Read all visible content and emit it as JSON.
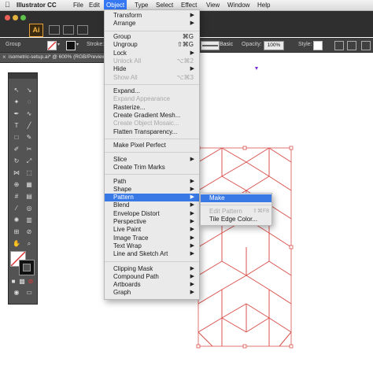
{
  "menubar": {
    "app_name": "Illustrator CC",
    "items": [
      "File",
      "Edit",
      "Object",
      "Type",
      "Select",
      "Effect",
      "View",
      "Window",
      "Help"
    ]
  },
  "appbar": {
    "logo": "Ai"
  },
  "control_bar": {
    "selection_label": "Group",
    "stroke_label": "Stroke:",
    "profile_label": "Basic",
    "opacity_label": "Opacity:",
    "opacity_value": "100%",
    "style_label": "Style:"
  },
  "document_tab": {
    "close": "×",
    "title": "isometric-setup.ai* @ 600% (RGB/Preview)"
  },
  "object_menu": {
    "items": [
      {
        "label": "Transform",
        "arrow": "▶"
      },
      {
        "label": "Arrange",
        "arrow": "▶"
      },
      {
        "label": "Group",
        "shortcut": "⌘G"
      },
      {
        "label": "Ungroup",
        "shortcut": "⇧⌘G"
      },
      {
        "label": "Lock",
        "arrow": "▶"
      },
      {
        "label": "Unlock All",
        "shortcut": "⌥⌘2"
      },
      {
        "label": "Hide",
        "arrow": "▶"
      },
      {
        "label": "Show All",
        "shortcut": "⌥⌘3"
      },
      {
        "label": "Expand..."
      },
      {
        "label": "Expand Appearance"
      },
      {
        "label": "Rasterize..."
      },
      {
        "label": "Create Gradient Mesh..."
      },
      {
        "label": "Create Object Mosaic..."
      },
      {
        "label": "Flatten Transparency..."
      },
      {
        "label": "Make Pixel Perfect"
      },
      {
        "label": "Slice",
        "arrow": "▶"
      },
      {
        "label": "Create Trim Marks"
      },
      {
        "label": "Path",
        "arrow": "▶"
      },
      {
        "label": "Shape",
        "arrow": "▶"
      },
      {
        "label": "Pattern",
        "arrow": "▶"
      },
      {
        "label": "Blend",
        "arrow": "▶"
      },
      {
        "label": "Envelope Distort",
        "arrow": "▶"
      },
      {
        "label": "Perspective",
        "arrow": "▶"
      },
      {
        "label": "Live Paint",
        "arrow": "▶"
      },
      {
        "label": "Image Trace",
        "arrow": "▶"
      },
      {
        "label": "Text Wrap",
        "arrow": "▶"
      },
      {
        "label": "Line and Sketch Art",
        "arrow": "▶"
      },
      {
        "label": "Clipping Mask",
        "arrow": "▶"
      },
      {
        "label": "Compound Path",
        "arrow": "▶"
      },
      {
        "label": "Artboards",
        "arrow": "▶"
      },
      {
        "label": "Graph",
        "arrow": "▶"
      }
    ]
  },
  "pattern_submenu": {
    "items": [
      {
        "label": "Make"
      },
      {
        "label": "Edit Pattern",
        "shortcut": "⇧⌘F8"
      },
      {
        "label": "Tile Edge Color..."
      }
    ]
  },
  "colors": {
    "menu_highlight": "#3879e6",
    "artwork_stroke": "#d9534f",
    "accent_orange": "#f2b33d"
  }
}
